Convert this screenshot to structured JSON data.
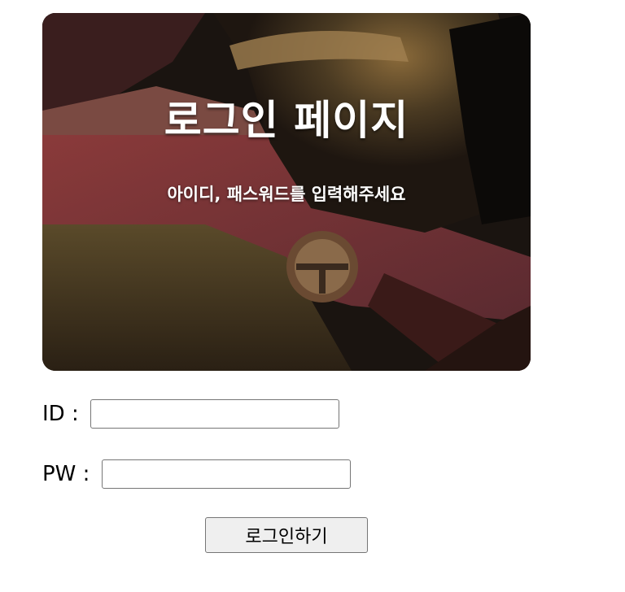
{
  "hero": {
    "title": "로그인 페이지",
    "subtitle": "아이디, 패스워드를 입력해주세요"
  },
  "form": {
    "id_label": "ID : ",
    "id_value": "",
    "pw_label": "PW : ",
    "pw_value": "",
    "submit_label": "로그인하기"
  },
  "colors": {
    "button_bg": "#efefef",
    "input_border": "#767676",
    "hero_text": "#ffffff"
  }
}
